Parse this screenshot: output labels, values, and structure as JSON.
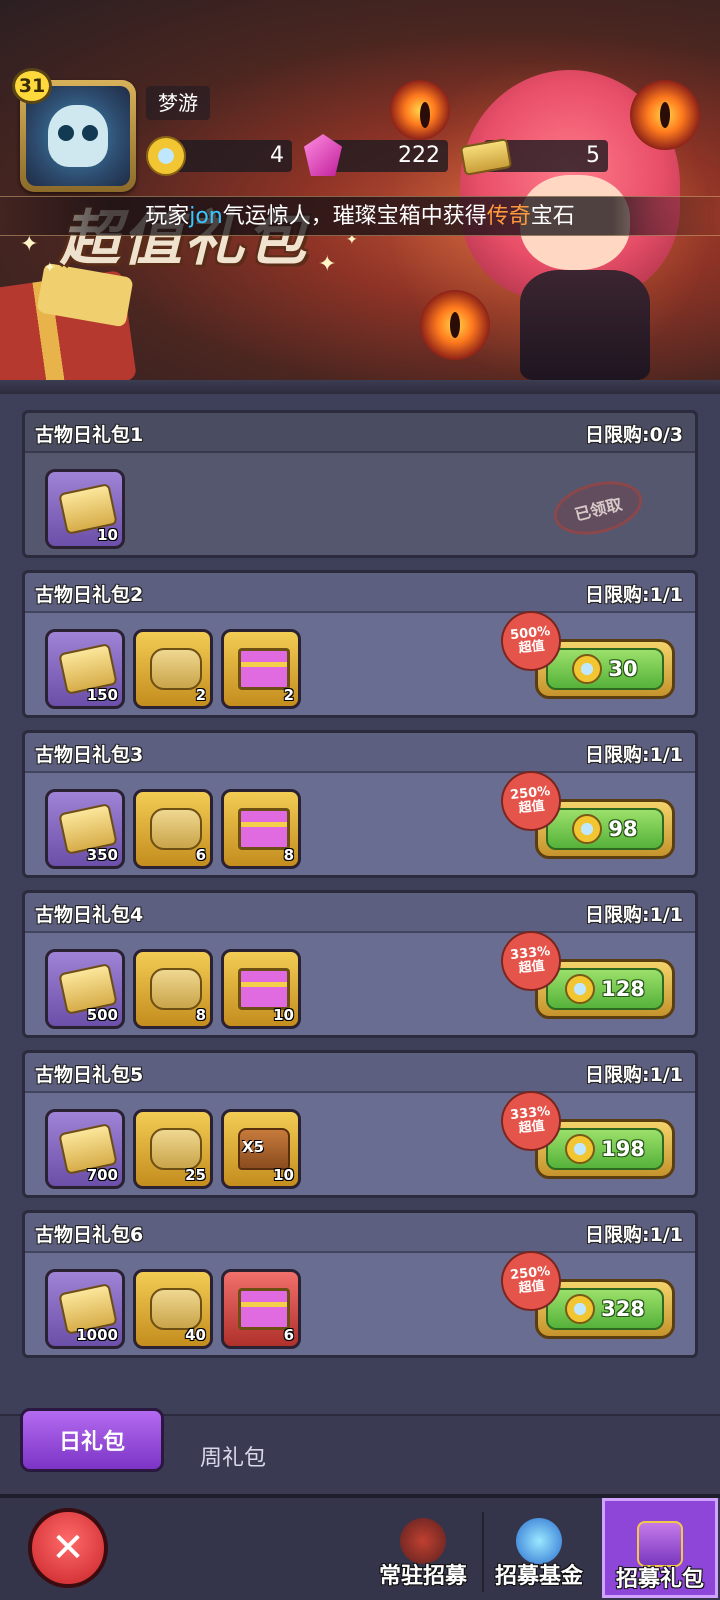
{
  "player": {
    "level": "31",
    "name": "梦游"
  },
  "resources": {
    "coins": "4",
    "gems": "222",
    "tickets": "5"
  },
  "banner": {
    "title": "超值礼包"
  },
  "news": {
    "prefix": "玩家",
    "player": "jon",
    "middle": "气运惊人，璀璨宝箱中获得",
    "highlight": "传奇",
    "suffix": "宝石",
    "colors": {
      "player": "#39c6ff",
      "highlight": "#ff9a3c"
    }
  },
  "packages": [
    {
      "title": "古物日礼包1",
      "limit": "日限购:0/3",
      "claimed": true,
      "stamp": "已领取",
      "items": [
        {
          "icon": "ticket-icon",
          "qty": "10",
          "frame": "purple"
        }
      ]
    },
    {
      "title": "古物日礼包2",
      "limit": "日限购:1/1",
      "badge_pct": "500%",
      "badge_label": "超值",
      "price": "30",
      "items": [
        {
          "icon": "ticket-icon",
          "qty": "150",
          "frame": "purple"
        },
        {
          "icon": "stone-icon",
          "qty": "2",
          "frame": "gold"
        },
        {
          "icon": "chest-icon",
          "qty": "2",
          "frame": "gold"
        }
      ]
    },
    {
      "title": "古物日礼包3",
      "limit": "日限购:1/1",
      "badge_pct": "250%",
      "badge_label": "超值",
      "price": "98",
      "items": [
        {
          "icon": "ticket-icon",
          "qty": "350",
          "frame": "purple"
        },
        {
          "icon": "stone-icon",
          "qty": "6",
          "frame": "gold"
        },
        {
          "icon": "chest-icon",
          "qty": "8",
          "frame": "gold"
        }
      ]
    },
    {
      "title": "古物日礼包4",
      "limit": "日限购:1/1",
      "badge_pct": "333%",
      "badge_label": "超值",
      "price": "128",
      "items": [
        {
          "icon": "ticket-icon",
          "qty": "500",
          "frame": "purple"
        },
        {
          "icon": "stone-icon",
          "qty": "8",
          "frame": "gold"
        },
        {
          "icon": "chest-icon",
          "qty": "10",
          "frame": "gold"
        }
      ]
    },
    {
      "title": "古物日礼包5",
      "limit": "日限购:1/1",
      "badge_pct": "333%",
      "badge_label": "超值",
      "price": "198",
      "items": [
        {
          "icon": "ticket-icon",
          "qty": "700",
          "frame": "purple"
        },
        {
          "icon": "stone-icon",
          "qty": "25",
          "frame": "gold"
        },
        {
          "icon": "treasure-chest-x5-icon",
          "qty": "10",
          "frame": "gold",
          "tag": "X5"
        }
      ]
    },
    {
      "title": "古物日礼包6",
      "limit": "日限购:1/1",
      "badge_pct": "250%",
      "badge_label": "超值",
      "price": "328",
      "items": [
        {
          "icon": "ticket-icon",
          "qty": "1000",
          "frame": "purple"
        },
        {
          "icon": "stone-icon",
          "qty": "40",
          "frame": "gold"
        },
        {
          "icon": "chest-icon",
          "qty": "6",
          "frame": "red"
        }
      ]
    }
  ],
  "tabs": {
    "active": "日礼包",
    "inactive": "周礼包"
  },
  "bottom_nav": {
    "close_icon": "close-icon",
    "items": [
      "常驻招募",
      "招募基金",
      "招募礼包"
    ],
    "active_index": 2,
    "accent": "#8e46d8"
  }
}
